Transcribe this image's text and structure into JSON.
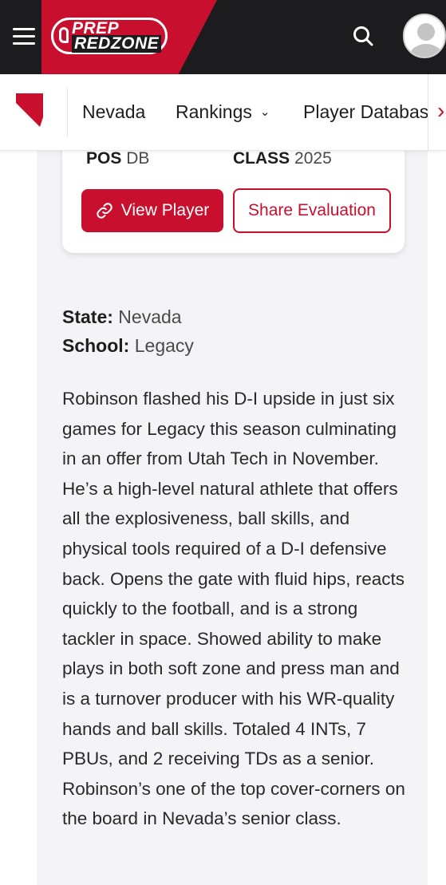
{
  "header": {
    "logo_line1": "PREP",
    "logo_line2": "REDZONE",
    "menu_icon": "hamburger-menu-icon",
    "search_icon": "search-icon",
    "avatar_icon": "user-avatar-icon",
    "brand_color": "#c8102e",
    "dark_color": "#1c1c1e"
  },
  "subnav": {
    "state_icon": "nevada-state-icon",
    "items": [
      {
        "label": "Nevada"
      },
      {
        "label": "Rankings",
        "icon": "chevron-down-icon"
      },
      {
        "label": "Player Databas"
      }
    ],
    "scroll_icon": "chevron-right-icon"
  },
  "player_card": {
    "pos_label": "POS",
    "pos_value": "DB",
    "class_label": "CLASS",
    "class_value": "2025",
    "view_button": "View Player",
    "view_icon": "link-icon",
    "share_button": "Share Evaluation"
  },
  "details": {
    "state_label": "State:",
    "state_value": "Nevada",
    "school_label": "School:",
    "school_value": "Legacy"
  },
  "evaluation": "Robinson flashed his D-I upside in just six games for Legacy this season culminating in an offer from Utah Tech in November. He’s a high-level natural athlete that offers all the explosiveness, ball skills, and physical tools required of a D-I defensive back. Opens the gate with fluid hips, reacts quickly to the football, and is a strong tackler in space. Showed ability to make plays in both soft zone and press man and is a turnover producer with his WR-quality hands and ball skills. Totaled 4 INTs, 7 PBUs, and 2 receiving TDs as a senior. Robinson’s one of the top cover-corners on the board in Nevada’s senior class."
}
